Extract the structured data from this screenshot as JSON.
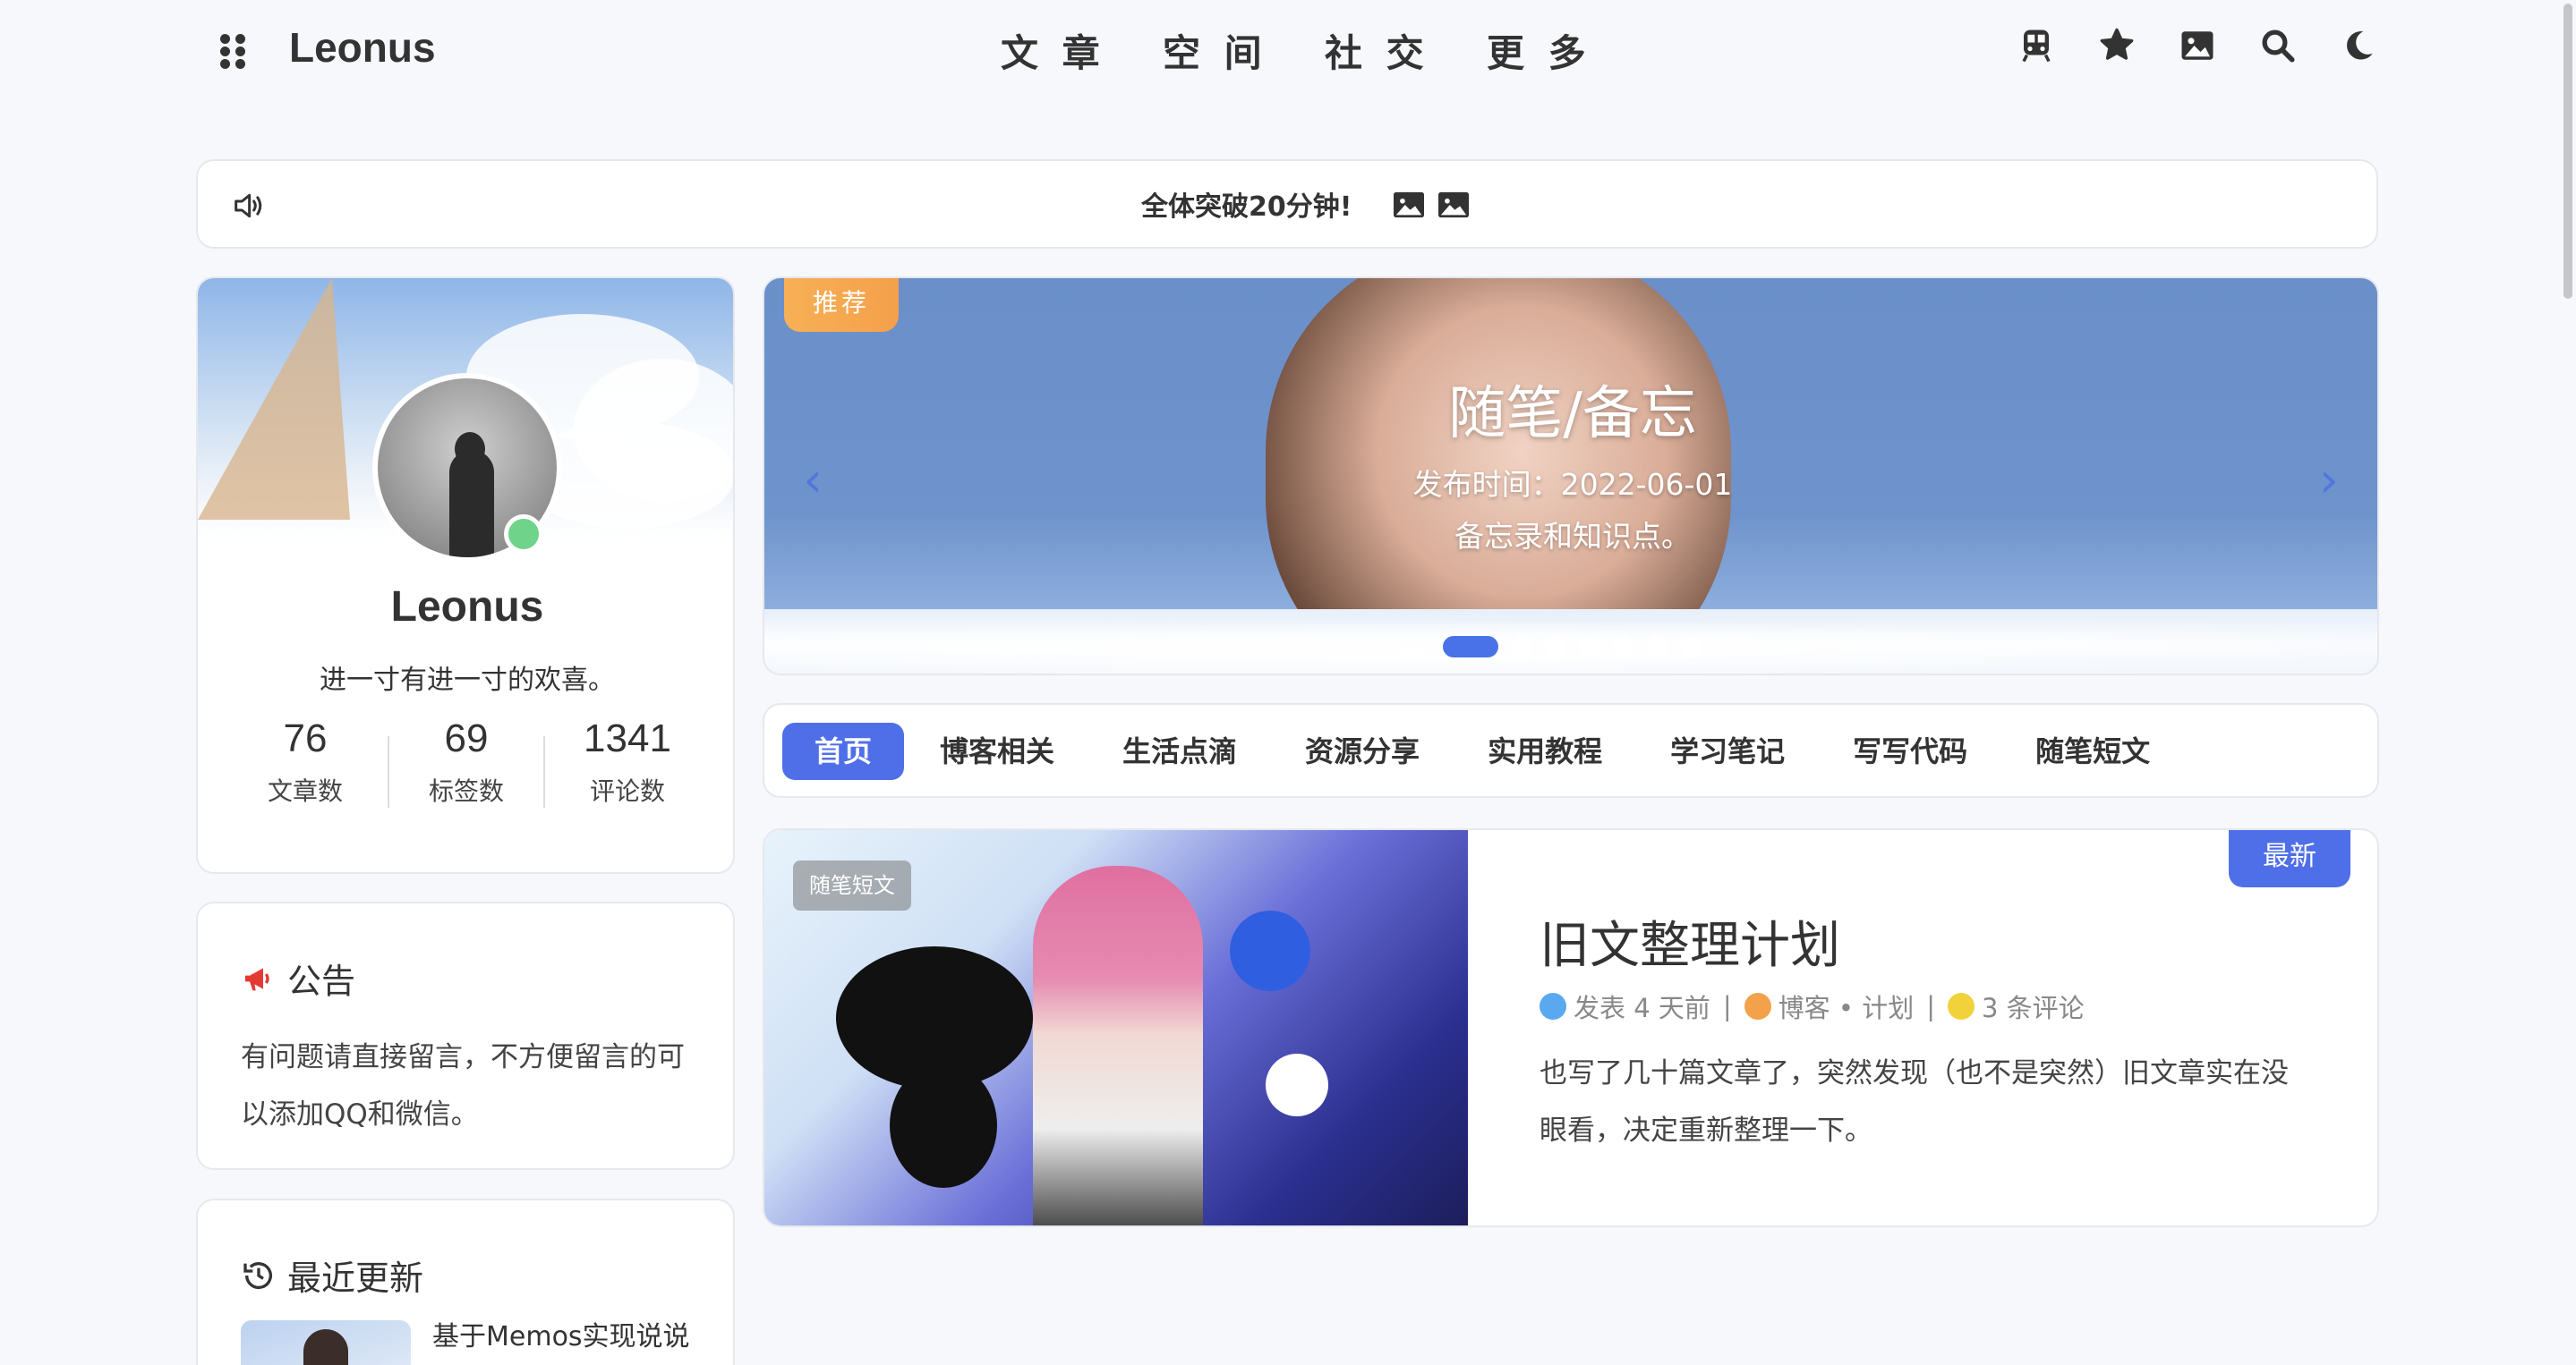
{
  "header": {
    "logo": "Leonus",
    "nav": [
      "文 章",
      "空 间",
      "社 交",
      "更 多"
    ],
    "icons": [
      "train-icon",
      "puzzle-icon",
      "image-icon",
      "search-icon",
      "moon-icon"
    ]
  },
  "notice": {
    "text": "全体突破20分钟!"
  },
  "profile": {
    "name": "Leonus",
    "bio": "进一寸有进一寸的欢喜。",
    "stats": [
      {
        "num": "76",
        "label": "文章数"
      },
      {
        "num": "69",
        "label": "标签数"
      },
      {
        "num": "1341",
        "label": "评论数"
      }
    ]
  },
  "announce": {
    "title": "公告",
    "body": "有问题请直接留言，不方便留言的可以添加QQ和微信。"
  },
  "recent": {
    "title": "最近更新",
    "item_title": "基于Memos实现说说"
  },
  "banner": {
    "badge": "推荐",
    "title": "随笔/备忘",
    "date": "发布时间：2022-06-01",
    "desc": "备忘录和知识点。",
    "dot_count": 7,
    "active_dot": 0,
    "accent": "#4a72e8"
  },
  "tabs": [
    "首页",
    "博客相关",
    "生活点滴",
    "资源分享",
    "实用教程",
    "学习笔记",
    "写写代码",
    "随笔短文"
  ],
  "post": {
    "tag": "随笔短文",
    "badge": "最新",
    "title": "旧文整理计划",
    "meta_time": "发表 4 天前",
    "meta_category": "博客 • 计划",
    "meta_comments": "3 条评论",
    "excerpt": "也写了几十篇文章了，突然发现（也不是突然）旧文章实在没眼看，决定重新整理一下。"
  }
}
